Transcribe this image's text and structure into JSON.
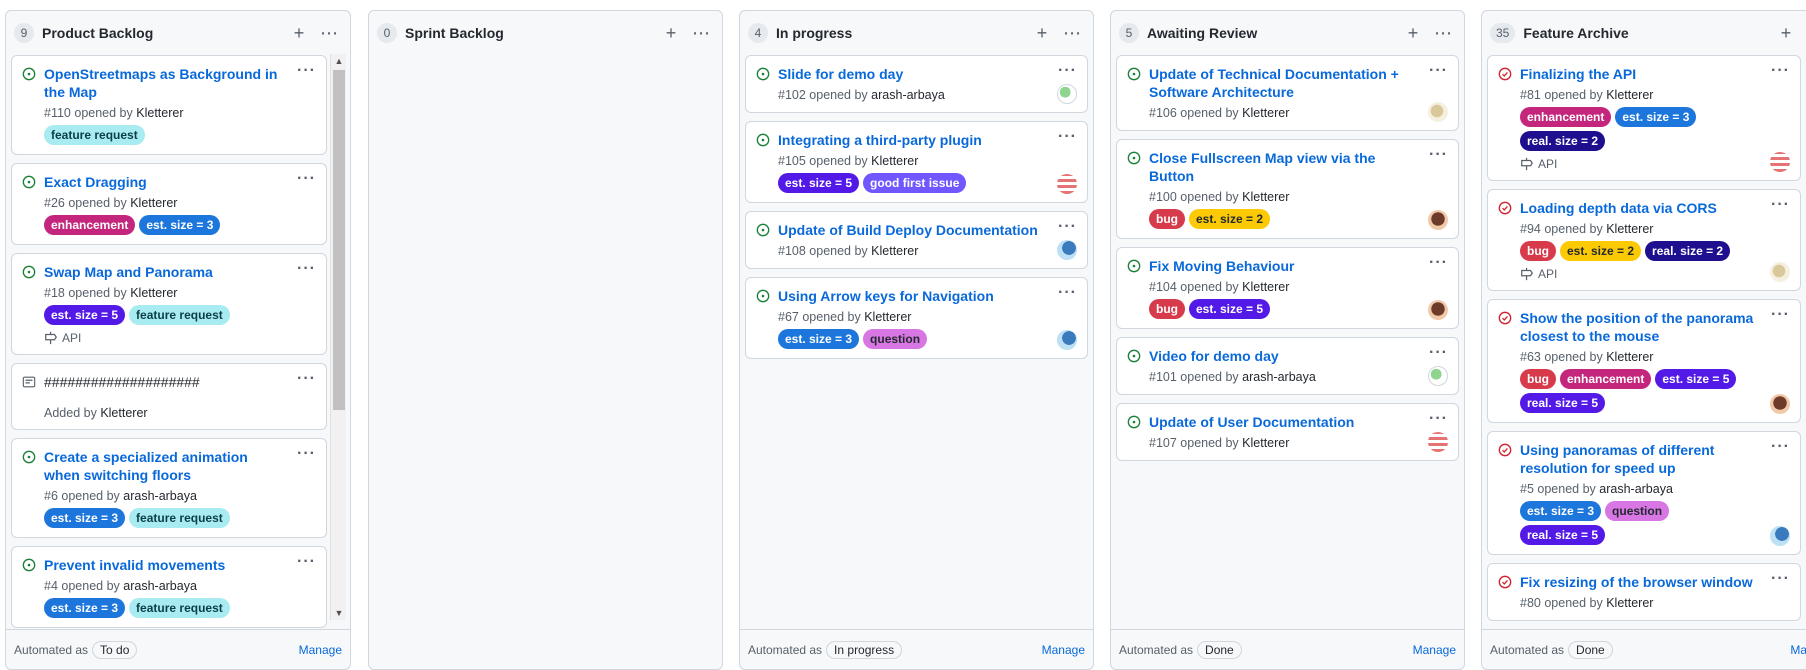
{
  "columns": [
    {
      "count": "9",
      "title": "Product Backlog",
      "automated_label": "Automated as",
      "automated_value": "To do",
      "manage": "Manage",
      "cards": [
        {
          "title": "OpenStreetmaps as Background in the Map",
          "number": "#110",
          "opened_by": "opened by",
          "author": "Kletterer",
          "labels": [
            {
              "text": "feature request",
              "cls": "lbl-feature"
            }
          ]
        },
        {
          "title": "Exact Dragging",
          "number": "#26",
          "opened_by": "opened by",
          "author": "Kletterer",
          "labels": [
            {
              "text": "enhancement",
              "cls": "lbl-enh"
            },
            {
              "text": "est. size = 3",
              "cls": "lbl-est3"
            }
          ]
        },
        {
          "title": "Swap Map and Panorama",
          "number": "#18",
          "opened_by": "opened by",
          "author": "Kletterer",
          "labels": [
            {
              "text": "est. size = 5",
              "cls": "lbl-est5"
            },
            {
              "text": "feature request",
              "cls": "lbl-feature"
            }
          ],
          "milestone": "API"
        },
        {
          "note": true,
          "title": "####################",
          "added_by": "Added by",
          "author": "Kletterer"
        },
        {
          "title": "Create a specialized animation when switching floors",
          "number": "#6",
          "opened_by": "opened by",
          "author": "arash-arbaya",
          "labels": [
            {
              "text": "est. size = 3",
              "cls": "lbl-est3"
            },
            {
              "text": "feature request",
              "cls": "lbl-feature"
            }
          ]
        },
        {
          "title": "Prevent invalid movements",
          "number": "#4",
          "opened_by": "opened by",
          "author": "arash-arbaya",
          "labels": [
            {
              "text": "est. size = 3",
              "cls": "lbl-est3"
            },
            {
              "text": "feature request",
              "cls": "lbl-feature"
            }
          ]
        }
      ]
    },
    {
      "count": "0",
      "title": "Sprint Backlog",
      "cards": []
    },
    {
      "count": "4",
      "title": "In progress",
      "automated_label": "Automated as",
      "automated_value": "In progress",
      "manage": "Manage",
      "cards": [
        {
          "title": "Slide for demo day",
          "number": "#102",
          "opened_by": "opened by",
          "author": "arash-arbaya",
          "labels": [],
          "avatar": "av1"
        },
        {
          "title": "Integrating a third-party plugin",
          "number": "#105",
          "opened_by": "opened by",
          "author": "Kletterer",
          "labels": [
            {
              "text": "est. size = 5",
              "cls": "lbl-est5"
            },
            {
              "text": "good first issue",
              "cls": "lbl-gfi"
            }
          ],
          "avatar": "av2"
        },
        {
          "title": "Update of Build Deploy Documentation",
          "number": "#108",
          "opened_by": "opened by",
          "author": "Kletterer",
          "labels": [],
          "avatar": "av3"
        },
        {
          "title": "Using Arrow keys for Navigation",
          "number": "#67",
          "opened_by": "opened by",
          "author": "Kletterer",
          "labels": [
            {
              "text": "est. size = 3",
              "cls": "lbl-est3"
            },
            {
              "text": "question",
              "cls": "lbl-question"
            }
          ],
          "avatar": "av3"
        }
      ]
    },
    {
      "count": "5",
      "title": "Awaiting Review",
      "automated_label": "Automated as",
      "automated_value": "Done",
      "manage": "Manage",
      "cards": [
        {
          "title": "Update of Technical Documentation + Software Architecture",
          "number": "#106",
          "opened_by": "opened by",
          "author": "Kletterer",
          "labels": [],
          "avatar": "av5"
        },
        {
          "title": "Close Fullscreen Map view via the Button",
          "number": "#100",
          "opened_by": "opened by",
          "author": "Kletterer",
          "labels": [
            {
              "text": "bug",
              "cls": "lbl-bug"
            },
            {
              "text": "est. size = 2",
              "cls": "lbl-est2"
            }
          ],
          "avatar": "av4"
        },
        {
          "title": "Fix Moving Behaviour",
          "number": "#104",
          "opened_by": "opened by",
          "author": "Kletterer",
          "labels": [
            {
              "text": "bug",
              "cls": "lbl-bug"
            },
            {
              "text": "est. size = 5",
              "cls": "lbl-est5"
            }
          ],
          "avatar": "av4"
        },
        {
          "title": "Video for demo day",
          "number": "#101",
          "opened_by": "opened by",
          "author": "arash-arbaya",
          "labels": [],
          "avatar": "av1"
        },
        {
          "title": "Update of User Documentation",
          "number": "#107",
          "opened_by": "opened by",
          "author": "Kletterer",
          "labels": [],
          "avatar": "av2"
        }
      ]
    },
    {
      "count": "35",
      "title": "Feature Archive",
      "automated_label": "Automated as",
      "automated_value": "Done",
      "manage": "Mar",
      "cards": [
        {
          "closed": true,
          "title": "Finalizing the API",
          "number": "#81",
          "opened_by": "opened by",
          "author": "Kletterer",
          "labels": [
            {
              "text": "enhancement",
              "cls": "lbl-enh"
            },
            {
              "text": "est. size = 3",
              "cls": "lbl-est3"
            },
            {
              "text": "real. size = 2",
              "cls": "lbl-real"
            }
          ],
          "milestone": "API",
          "avatar": "av2"
        },
        {
          "closed": true,
          "title": "Loading depth data via CORS",
          "number": "#94",
          "opened_by": "opened by",
          "author": "Kletterer",
          "labels": [
            {
              "text": "bug",
              "cls": "lbl-bug"
            },
            {
              "text": "est. size = 2",
              "cls": "lbl-est2"
            },
            {
              "text": "real. size = 2",
              "cls": "lbl-real"
            }
          ],
          "milestone": "API",
          "avatar": "av5"
        },
        {
          "closed": true,
          "title": "Show the position of the panorama closest to the mouse",
          "number": "#63",
          "opened_by": "opened by",
          "author": "Kletterer",
          "labels": [
            {
              "text": "bug",
              "cls": "lbl-bug"
            },
            {
              "text": "enhancement",
              "cls": "lbl-enh"
            },
            {
              "text": "est. size = 5",
              "cls": "lbl-est5"
            },
            {
              "text": "real. size = 5",
              "cls": "lbl-est5"
            }
          ],
          "avatar": "av4"
        },
        {
          "closed": true,
          "title": "Using panoramas of different resolution for speed up",
          "number": "#5",
          "opened_by": "opened by",
          "author": "arash-arbaya",
          "labels": [
            {
              "text": "est. size = 3",
              "cls": "lbl-est3"
            },
            {
              "text": "question",
              "cls": "lbl-question"
            },
            {
              "text": "real. size = 5",
              "cls": "lbl-est5"
            }
          ],
          "avatar": "av3"
        },
        {
          "closed": true,
          "title": "Fix resizing of the browser window",
          "number": "#80",
          "opened_by": "opened by",
          "author": "Kletterer",
          "labels": []
        }
      ]
    }
  ],
  "milestone_label": "API",
  "colors": {
    "link": "#0969da",
    "open": "#1a7f37",
    "closed": "#cf222e"
  }
}
